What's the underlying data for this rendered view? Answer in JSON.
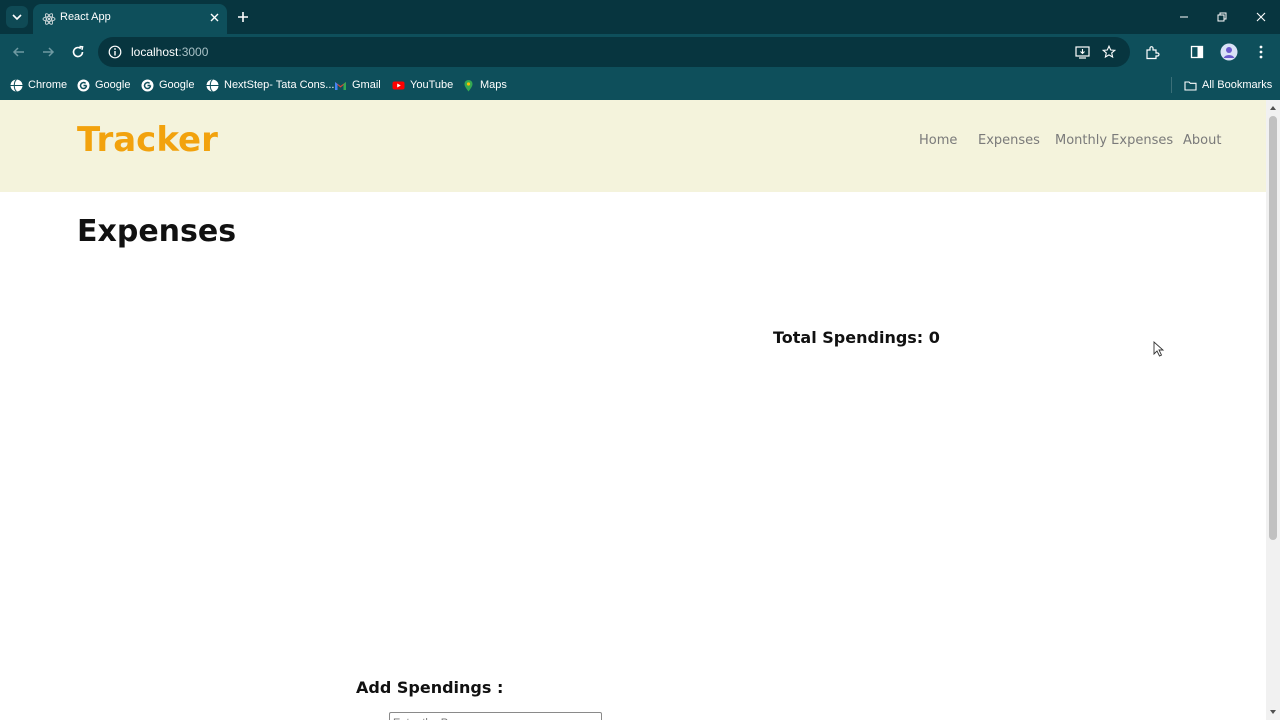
{
  "browser": {
    "tab_title": "React App",
    "url_host": "localhost",
    "url_port": ":3000",
    "bookmarks": [
      {
        "label": "Chrome",
        "icon": "globe-icon"
      },
      {
        "label": "Google",
        "icon": "google-icon"
      },
      {
        "label": "Google",
        "icon": "google-icon"
      },
      {
        "label": "NextStep- Tata Cons...",
        "icon": "globe-icon"
      },
      {
        "label": "Gmail",
        "icon": "gmail-icon"
      },
      {
        "label": "YouTube",
        "icon": "youtube-icon"
      },
      {
        "label": "Maps",
        "icon": "maps-icon"
      }
    ],
    "all_bookmarks": "All Bookmarks"
  },
  "navbar": {
    "brand": "Tracker",
    "links": [
      "Home",
      "Expenses",
      "Monthly Expenses",
      "About"
    ]
  },
  "main": {
    "title": "Expenses",
    "total_label": "Total Spendings: 0",
    "add_label": "Add Spendings :",
    "purpose_placeholder": "Enter the Purpose"
  },
  "colors": {
    "brand": "#f2a20d",
    "navbar_bg": "#f4f3dc",
    "chrome_dark": "#07353f",
    "chrome_toolbar": "#0e4f5b"
  }
}
